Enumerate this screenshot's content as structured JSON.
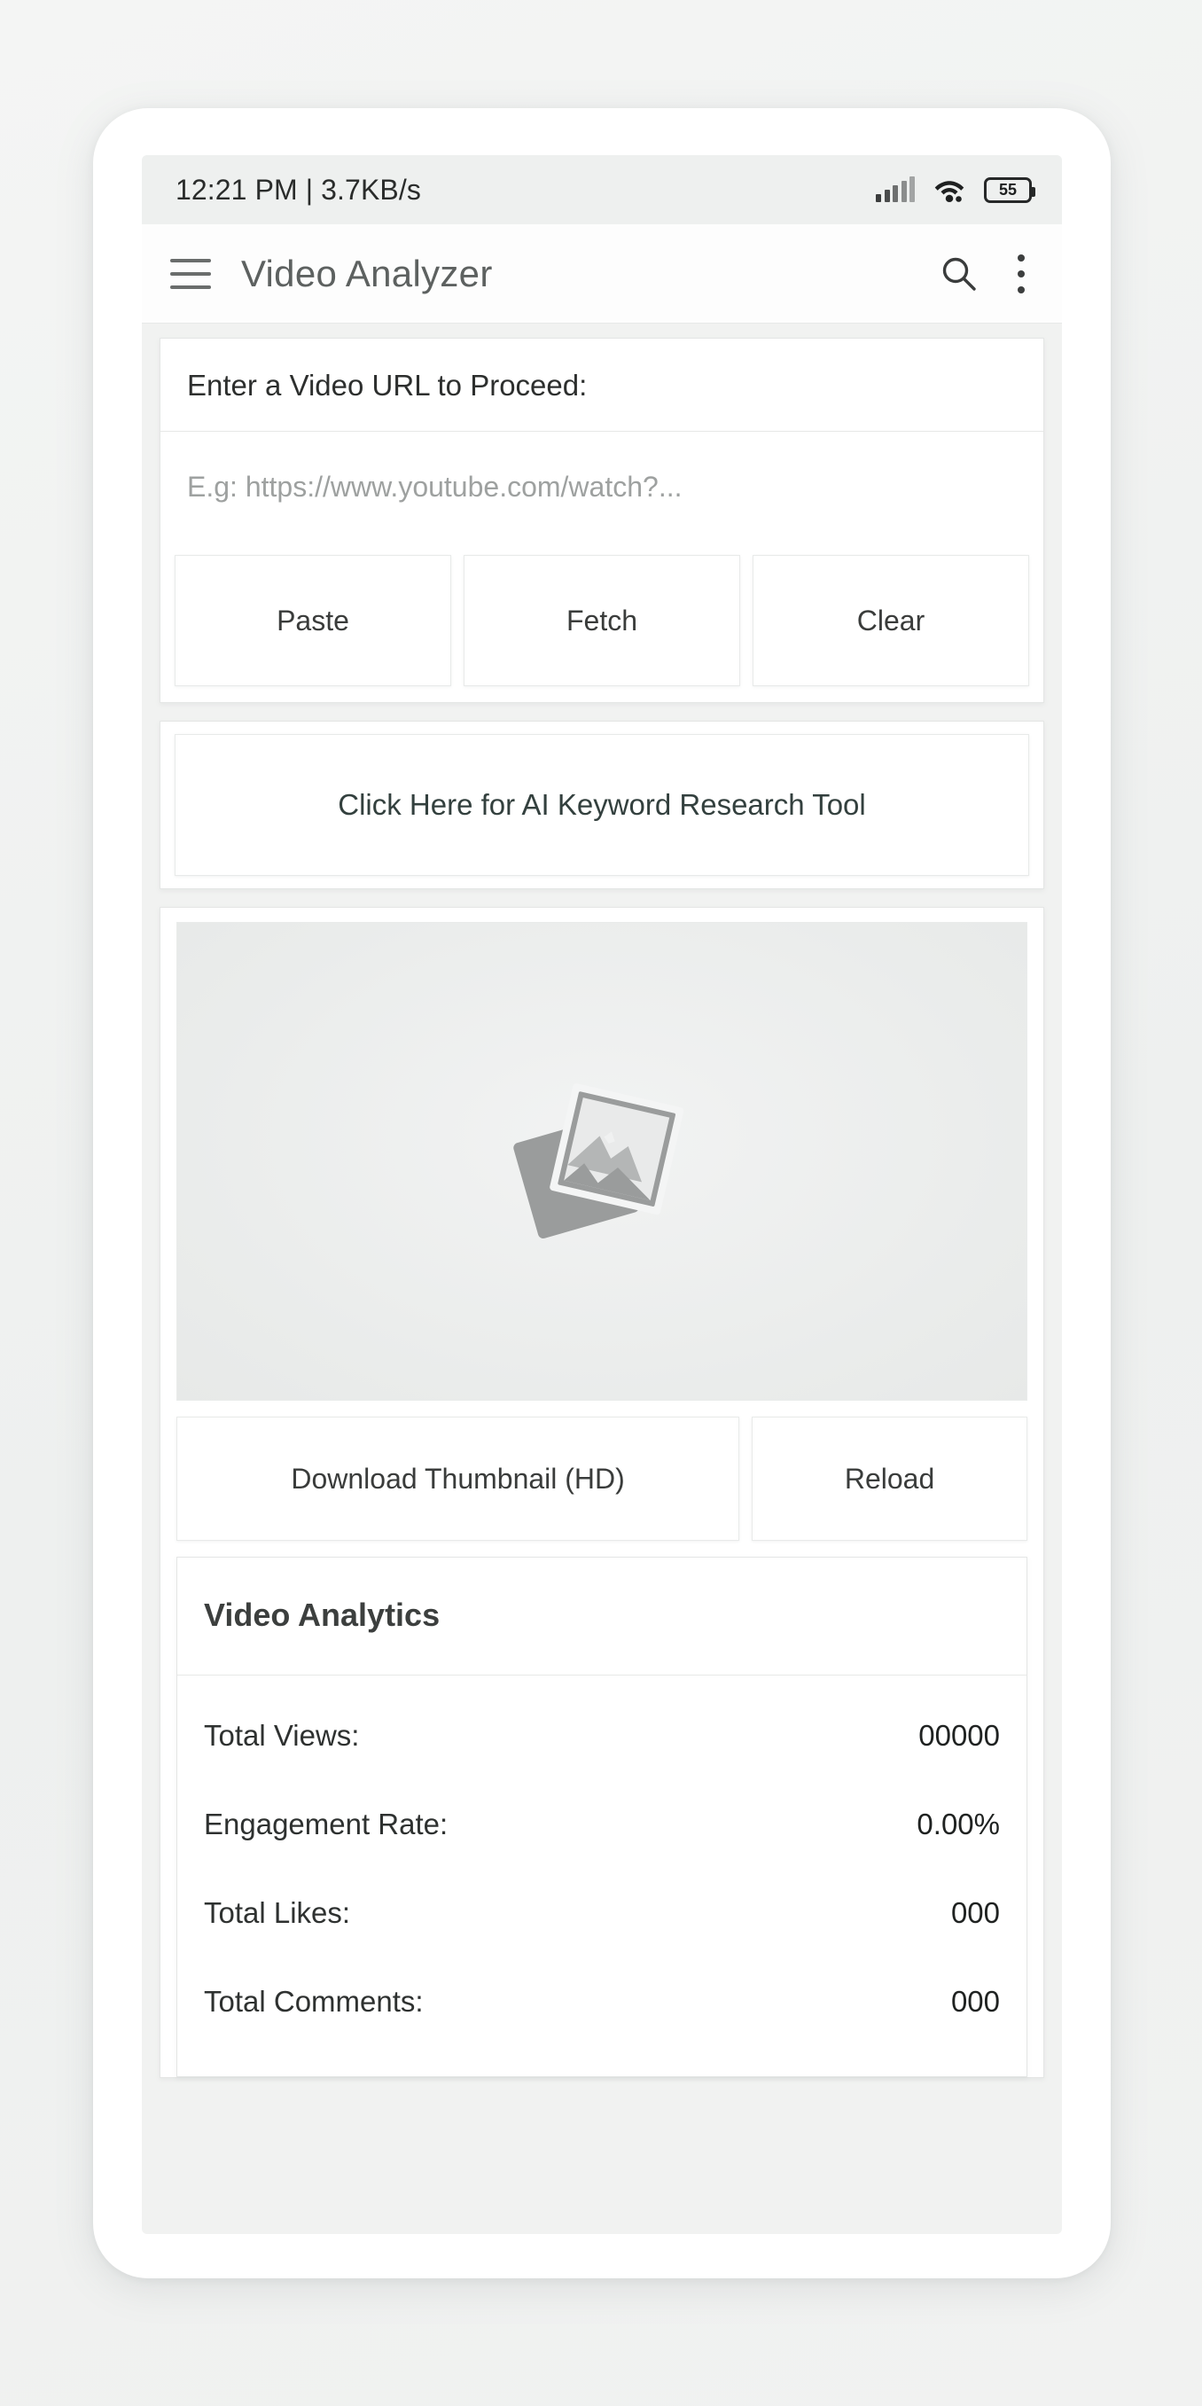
{
  "status_bar": {
    "left_text": "12:21 PM | 3.7KB/s",
    "battery_level": "55",
    "signal_icon": "signal-bars-icon",
    "wifi_icon": "wifi-icon"
  },
  "app_bar": {
    "menu_icon": "hamburger-menu-icon",
    "title": "Video Analyzer",
    "search_icon": "search-icon",
    "overflow_icon": "more-vertical-icon"
  },
  "url_section": {
    "label": "Enter a Video URL to Proceed:",
    "input_value": "",
    "input_placeholder": "E.g: https://www.youtube.com/watch?...",
    "buttons": [
      {
        "label": "Paste",
        "name": "paste-button"
      },
      {
        "label": "Fetch",
        "name": "fetch-button"
      },
      {
        "label": "Clear",
        "name": "clear-button"
      }
    ]
  },
  "keyword_tool": {
    "label": "Click Here for AI Keyword Research Tool"
  },
  "thumbnail_section": {
    "placeholder_icon": "broken-image-placeholder-icon",
    "download_label": "Download Thumbnail (HD)",
    "reload_label": "Reload"
  },
  "analytics": {
    "title": "Video Analytics",
    "rows": [
      {
        "label": "Total Views:",
        "value": "00000"
      },
      {
        "label": "Engagement Rate:",
        "value": "0.00%"
      },
      {
        "label": "Total Likes:",
        "value": "000"
      },
      {
        "label": "Total Comments:",
        "value": "000"
      }
    ]
  },
  "colors": {
    "page_background": "#f1f2f1",
    "card_background": "#ffffff",
    "app_bar_background": "#fdfdfd",
    "status_bar_background": "#eef0ef",
    "title_text": "#5d6160",
    "body_text": "#2d2f2e",
    "placeholder_text": "#9ea1a0",
    "border": "#e4e6e5"
  }
}
